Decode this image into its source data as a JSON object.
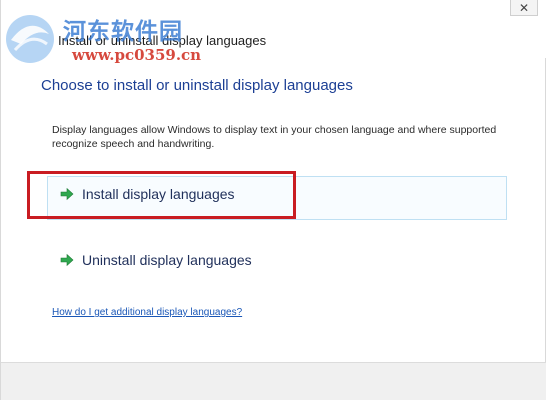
{
  "window": {
    "title": "Install or uninstall display languages",
    "close_glyph": "✕"
  },
  "watermark": {
    "site_name": "河东软件园",
    "url": "www.pc0359.cn"
  },
  "content": {
    "heading": "Choose to install or uninstall display languages",
    "description": "Display languages allow Windows to display text in your chosen language and where supported recognize speech and handwriting.",
    "install_label": "Install display languages",
    "uninstall_label": "Uninstall display languages",
    "help_link": "How do I get additional display languages?"
  },
  "colors": {
    "heading": "#1c3f94",
    "highlight": "#c91c22",
    "arrow": "#2fa84f",
    "link": "#1a57b7"
  },
  "icons": {
    "arrow": "green-arrow-icon",
    "close": "close-icon",
    "logo": "watermark-logo-icon"
  }
}
